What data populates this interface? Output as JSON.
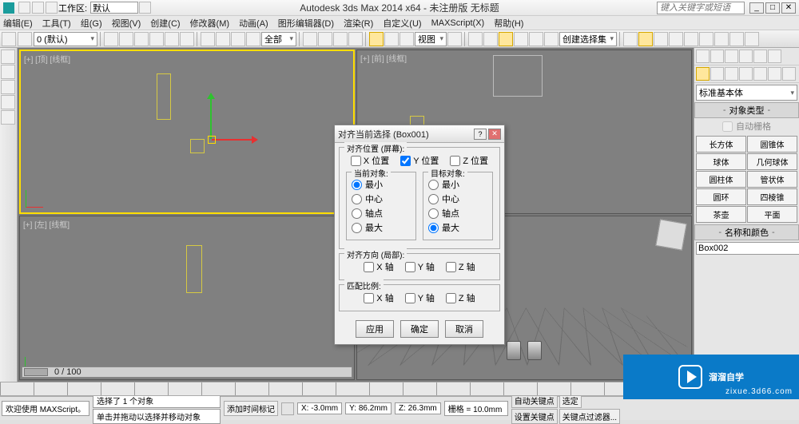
{
  "title": "Autodesk 3ds Max  2014 x64   - 未注册版   无标题",
  "workspace": {
    "label": "工作区:",
    "value": "默认"
  },
  "search_placeholder": "键入关键字或短语",
  "menu": [
    "编辑(E)",
    "工具(T)",
    "组(G)",
    "视图(V)",
    "创建(C)",
    "修改器(M)",
    "动画(A)",
    "图形编辑器(D)",
    "渲染(R)",
    "自定义(U)",
    "MAXScript(X)",
    "帮助(H)"
  ],
  "layer_selector": "0 (默认)",
  "toolbar": {
    "scope": "全部",
    "view": "视图",
    "create_sel_set": "创建选择集"
  },
  "viewport_labels": {
    "top": "[+] [顶] [线框]",
    "front": "[+] [前] [线框]",
    "left": "[+] [左] [线框]",
    "persp": ""
  },
  "scroll_label": "0 / 100",
  "right_panel": {
    "category": "标准基本体",
    "section_objtype": "对象类型",
    "autogrid": "自动栅格",
    "primitives": [
      "长方体",
      "圆锥体",
      "球体",
      "几何球体",
      "圆柱体",
      "管状体",
      "圆环",
      "四棱锥",
      "茶壶",
      "平面"
    ],
    "section_name": "名称和颜色",
    "object_name": "Box002"
  },
  "dialog": {
    "title": "对齐当前选择 (Box001)",
    "grp_pos": "对齐位置 (屏幕):",
    "chk_x": "X 位置",
    "chk_y": "Y 位置",
    "chk_z": "Z 位置",
    "grp_current": "当前对象:",
    "grp_target": "目标对象:",
    "r_min": "最小",
    "r_center": "中心",
    "r_pivot": "轴点",
    "r_max": "最大",
    "grp_orient": "对齐方向 (局部):",
    "axis_x": "X 轴",
    "axis_y": "Y 轴",
    "axis_z": "Z 轴",
    "grp_scale": "匹配比例:",
    "btn_apply": "应用",
    "btn_ok": "确定",
    "btn_cancel": "取消"
  },
  "status": {
    "welcome": "欢迎使用  MAXScript。",
    "sel": "选择了 1 个对象",
    "hint": "单击并拖动以选择并移动对象",
    "addtime": "添加时间标记",
    "x": "X: -3.0mm",
    "y": "Y: 86.2mm",
    "z": "Z: 26.3mm",
    "grid": "栅格 = 10.0mm",
    "auto_key": "自动关键点",
    "sel_lock": "选定",
    "set_key": "设置关键点",
    "key_filter": "关键点过滤器..."
  },
  "watermark": {
    "text": "溜溜自学",
    "sub": "zixue.3d66.com"
  }
}
